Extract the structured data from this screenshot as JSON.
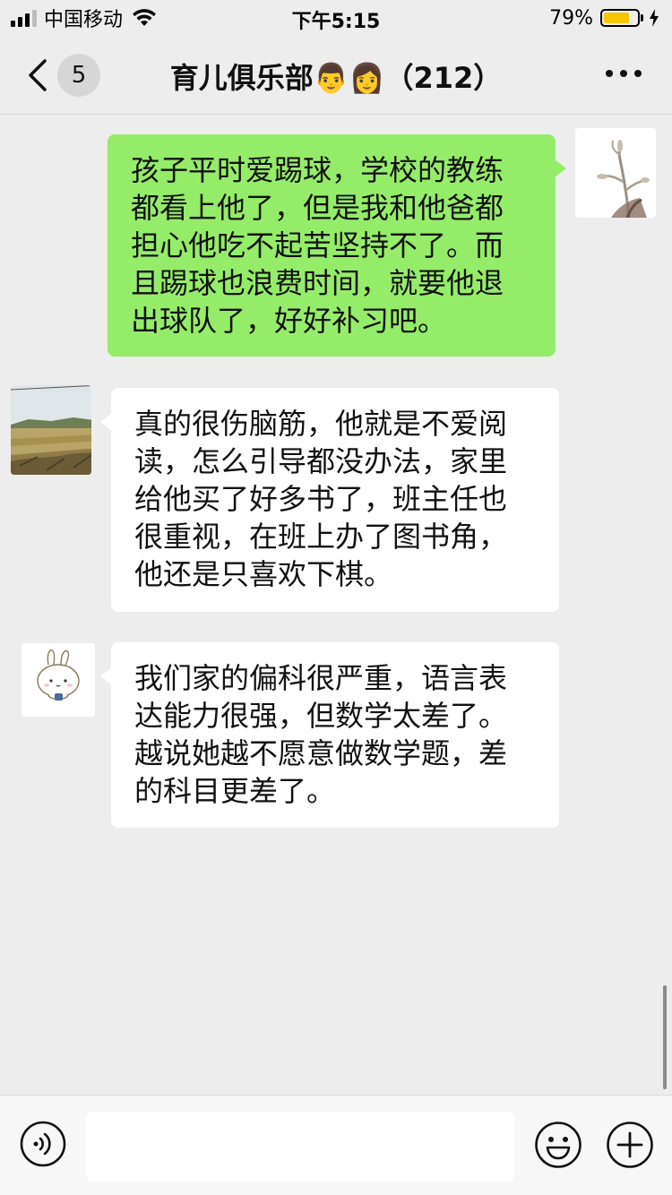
{
  "status_bar": {
    "carrier": "中国移动",
    "time": "下午5:15",
    "battery_percent": "79%",
    "battery_level": 0.79,
    "battery_color": "#f7c600"
  },
  "nav": {
    "back_icon": "chevron-left-icon",
    "unread_count": "5",
    "title": "育儿俱乐部👨👩（212）",
    "more_icon": "more-dots-icon"
  },
  "messages": [
    {
      "sender": "me",
      "avatar": "dry-flower-photo",
      "text": "孩子平时爱踢球，学校的教练\n都看上他了，但是我和他爸都\n担心他吃不起苦坚持不了。而\n且踢球也浪费时间，就要他退\n出球队了，好好补习吧。"
    },
    {
      "sender": "other",
      "avatar": "field-landscape-photo",
      "text": "真的很伤脑筋，他就是不爱阅\n读，怎么引导都没办法，家里\n给他买了好多书了，班主任也\n很重视，在班上办了图书角，\n他还是只喜欢下棋。"
    },
    {
      "sender": "other",
      "avatar": "cartoon-bunny",
      "text": "我们家的偏科很严重，语言表\n达能力很强，但数学太差了。\n越说她越不愿意做数学题，差\n的科目更差了。"
    }
  ],
  "input_bar": {
    "voice_icon": "voice-icon",
    "input_value": "",
    "emoji_icon": "emoji-icon",
    "add_icon": "plus-circle-icon"
  },
  "colors": {
    "background": "#ededed",
    "my_bubble": "#95ec69",
    "other_bubble": "#ffffff"
  }
}
